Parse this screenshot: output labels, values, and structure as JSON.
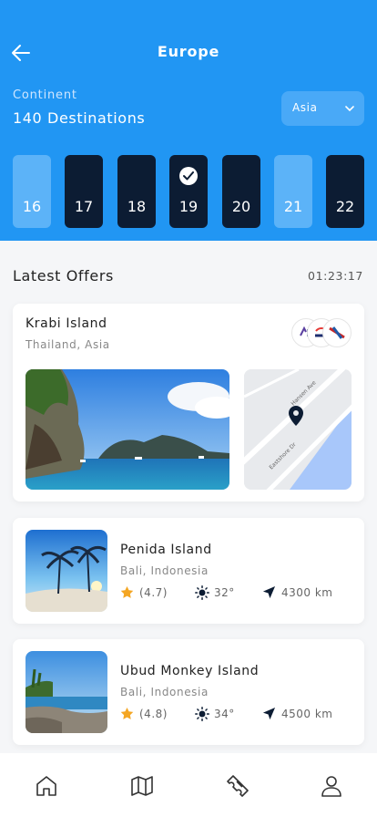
{
  "header": {
    "title": "Europe",
    "continent_label": "Continent",
    "destinations": "140 Destinations",
    "select_value": "Asia",
    "accent": "#2196f3"
  },
  "days": [
    {
      "num": "16",
      "style": "light",
      "selected": false
    },
    {
      "num": "17",
      "style": "dark",
      "selected": false
    },
    {
      "num": "18",
      "style": "dark",
      "selected": false
    },
    {
      "num": "19",
      "style": "dark",
      "selected": true
    },
    {
      "num": "20",
      "style": "dark",
      "selected": false
    },
    {
      "num": "21",
      "style": "light",
      "selected": false
    },
    {
      "num": "22",
      "style": "dark",
      "selected": false
    }
  ],
  "offers": {
    "title": "Latest Offers",
    "timer": "01:23:17"
  },
  "featured": {
    "name": "Krabi Island",
    "location": "Thailand, Asia",
    "map_labels": {
      "street1": "Hansen Ave",
      "street2": "Eastshore Dr"
    }
  },
  "destinations": [
    {
      "name": "Penida Island",
      "location": "Bali, Indonesia",
      "rating": "(4.7)",
      "temp": "32°",
      "distance": "4300 km"
    },
    {
      "name": "Ubud Monkey Island",
      "location": "Bali, Indonesia",
      "rating": "(4.8)",
      "temp": "34°",
      "distance": "4500 km"
    }
  ],
  "nav": [
    "home-icon",
    "map-icon",
    "ticket-icon",
    "profile-icon"
  ]
}
